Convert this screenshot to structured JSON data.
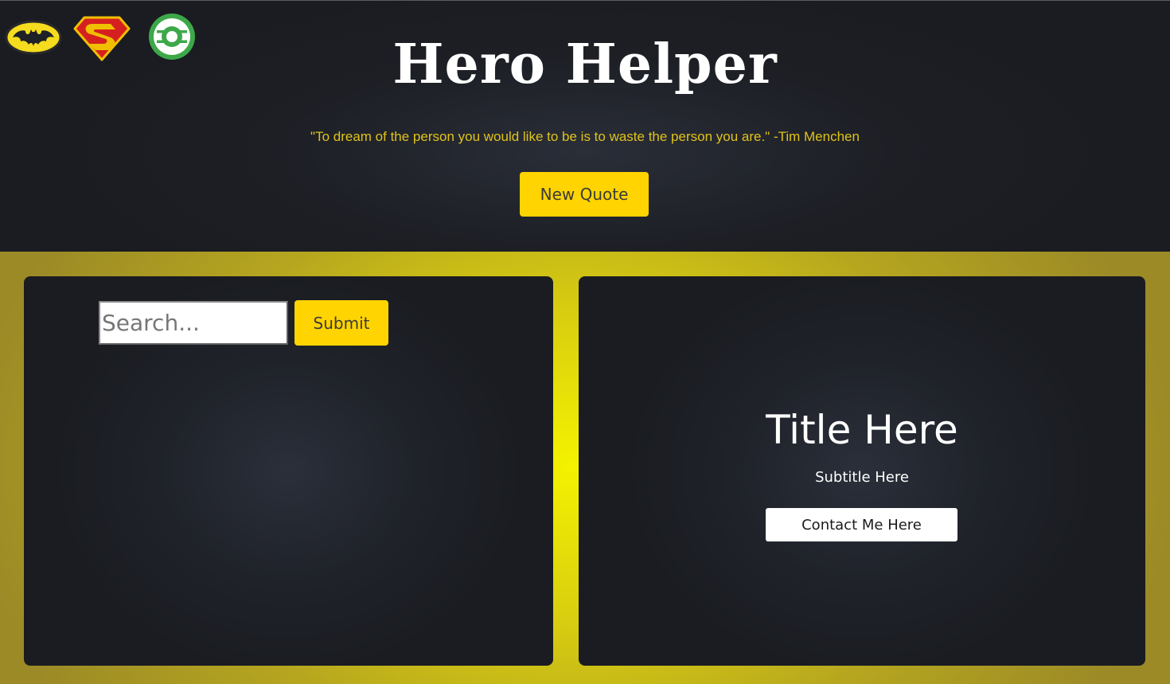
{
  "header": {
    "title": "Hero Helper",
    "quote": "\"To dream of the person you would like to be is to waste the person you are.\" -Tim Menchen",
    "new_quote_label": "New Quote",
    "logos": [
      "batman-logo-icon",
      "superman-logo-icon",
      "green-lantern-logo-icon"
    ]
  },
  "search": {
    "placeholder": "Search...",
    "value": "",
    "submit_label": "Submit"
  },
  "profile_card": {
    "title": "Title Here",
    "subtitle": "Subtitle Here",
    "contact_label": "Contact Me Here"
  },
  "colors": {
    "accent": "#ffd400",
    "quote_text": "#e0c31a",
    "card_bg": "#1f2229",
    "main_bg": "#d8cd10"
  }
}
